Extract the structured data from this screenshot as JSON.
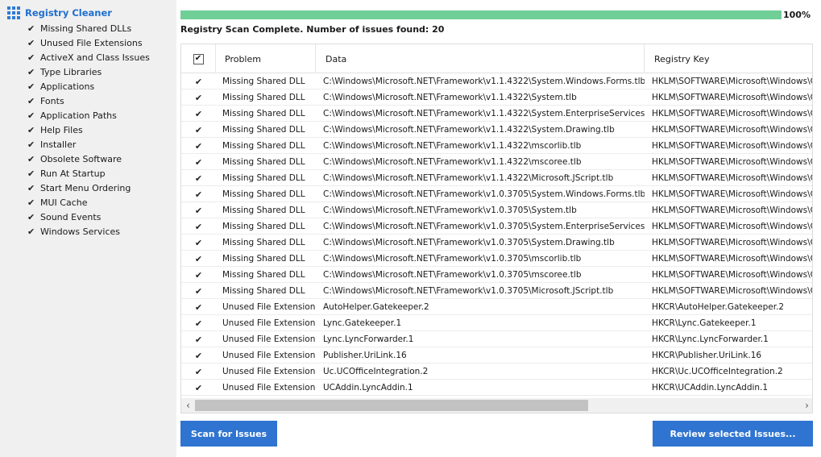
{
  "sidebar": {
    "title": "Registry Cleaner",
    "items": [
      {
        "label": "Missing Shared DLLs",
        "checked": true
      },
      {
        "label": "Unused File Extensions",
        "checked": true
      },
      {
        "label": "ActiveX and Class Issues",
        "checked": true
      },
      {
        "label": "Type Libraries",
        "checked": true
      },
      {
        "label": "Applications",
        "checked": true
      },
      {
        "label": "Fonts",
        "checked": true
      },
      {
        "label": "Application Paths",
        "checked": true
      },
      {
        "label": "Help Files",
        "checked": true
      },
      {
        "label": "Installer",
        "checked": true
      },
      {
        "label": "Obsolete Software",
        "checked": true
      },
      {
        "label": "Run At Startup",
        "checked": true
      },
      {
        "label": "Start Menu Ordering",
        "checked": true
      },
      {
        "label": "MUI Cache",
        "checked": true
      },
      {
        "label": "Sound Events",
        "checked": true
      },
      {
        "label": "Windows Services",
        "checked": true
      }
    ]
  },
  "progress": {
    "value": 1.0,
    "label": "100%"
  },
  "status_text": "Registry Scan Complete. Number of issues found: 20",
  "table": {
    "columns": [
      "Problem",
      "Data",
      "Registry Key"
    ],
    "header_checked": true,
    "rows": [
      {
        "problem": "Missing Shared DLL",
        "data": "C:\\Windows\\Microsoft.NET\\Framework\\v1.1.4322\\System.Windows.Forms.tlb",
        "key": "HKLM\\SOFTWARE\\Microsoft\\Windows\\Cur"
      },
      {
        "problem": "Missing Shared DLL",
        "data": "C:\\Windows\\Microsoft.NET\\Framework\\v1.1.4322\\System.tlb",
        "key": "HKLM\\SOFTWARE\\Microsoft\\Windows\\Cur"
      },
      {
        "problem": "Missing Shared DLL",
        "data": "C:\\Windows\\Microsoft.NET\\Framework\\v1.1.4322\\System.EnterpriseServices.tlb",
        "key": "HKLM\\SOFTWARE\\Microsoft\\Windows\\Cur"
      },
      {
        "problem": "Missing Shared DLL",
        "data": "C:\\Windows\\Microsoft.NET\\Framework\\v1.1.4322\\System.Drawing.tlb",
        "key": "HKLM\\SOFTWARE\\Microsoft\\Windows\\Cur"
      },
      {
        "problem": "Missing Shared DLL",
        "data": "C:\\Windows\\Microsoft.NET\\Framework\\v1.1.4322\\mscorlib.tlb",
        "key": "HKLM\\SOFTWARE\\Microsoft\\Windows\\Cur"
      },
      {
        "problem": "Missing Shared DLL",
        "data": "C:\\Windows\\Microsoft.NET\\Framework\\v1.1.4322\\mscoree.tlb",
        "key": "HKLM\\SOFTWARE\\Microsoft\\Windows\\Cur"
      },
      {
        "problem": "Missing Shared DLL",
        "data": "C:\\Windows\\Microsoft.NET\\Framework\\v1.1.4322\\Microsoft.JScript.tlb",
        "key": "HKLM\\SOFTWARE\\Microsoft\\Windows\\Cur"
      },
      {
        "problem": "Missing Shared DLL",
        "data": "C:\\Windows\\Microsoft.NET\\Framework\\v1.0.3705\\System.Windows.Forms.tlb",
        "key": "HKLM\\SOFTWARE\\Microsoft\\Windows\\Cur"
      },
      {
        "problem": "Missing Shared DLL",
        "data": "C:\\Windows\\Microsoft.NET\\Framework\\v1.0.3705\\System.tlb",
        "key": "HKLM\\SOFTWARE\\Microsoft\\Windows\\Cur"
      },
      {
        "problem": "Missing Shared DLL",
        "data": "C:\\Windows\\Microsoft.NET\\Framework\\v1.0.3705\\System.EnterpriseServices.tlb",
        "key": "HKLM\\SOFTWARE\\Microsoft\\Windows\\Cur"
      },
      {
        "problem": "Missing Shared DLL",
        "data": "C:\\Windows\\Microsoft.NET\\Framework\\v1.0.3705\\System.Drawing.tlb",
        "key": "HKLM\\SOFTWARE\\Microsoft\\Windows\\Cur"
      },
      {
        "problem": "Missing Shared DLL",
        "data": "C:\\Windows\\Microsoft.NET\\Framework\\v1.0.3705\\mscorlib.tlb",
        "key": "HKLM\\SOFTWARE\\Microsoft\\Windows\\Cur"
      },
      {
        "problem": "Missing Shared DLL",
        "data": "C:\\Windows\\Microsoft.NET\\Framework\\v1.0.3705\\mscoree.tlb",
        "key": "HKLM\\SOFTWARE\\Microsoft\\Windows\\Cur"
      },
      {
        "problem": "Missing Shared DLL",
        "data": "C:\\Windows\\Microsoft.NET\\Framework\\v1.0.3705\\Microsoft.JScript.tlb",
        "key": "HKLM\\SOFTWARE\\Microsoft\\Windows\\Cur"
      },
      {
        "problem": "Unused File Extension",
        "data": "AutoHelper.Gatekeeper.2",
        "key": "HKCR\\AutoHelper.Gatekeeper.2"
      },
      {
        "problem": "Unused File Extension",
        "data": "Lync.Gatekeeper.1",
        "key": "HKCR\\Lync.Gatekeeper.1"
      },
      {
        "problem": "Unused File Extension",
        "data": "Lync.LyncForwarder.1",
        "key": "HKCR\\Lync.LyncForwarder.1"
      },
      {
        "problem": "Unused File Extension",
        "data": "Publisher.UriLink.16",
        "key": "HKCR\\Publisher.UriLink.16"
      },
      {
        "problem": "Unused File Extension",
        "data": "Uc.UCOfficeIntegration.2",
        "key": "HKCR\\Uc.UCOfficeIntegration.2"
      },
      {
        "problem": "Unused File Extension",
        "data": "UCAddin.LyncAddin.1",
        "key": "HKCR\\UCAddin.LyncAddin.1"
      }
    ]
  },
  "buttons": {
    "scan": "Scan for Issues",
    "review": "Review selected Issues..."
  },
  "icons": {
    "header": "grid-icon",
    "check": "check-icon",
    "scroll_left": "chevron-left-icon",
    "scroll_right": "chevron-right-icon"
  },
  "colors": {
    "accent": "#2f74d0",
    "title_blue": "#1f6fd0",
    "progress": "#6fcf97",
    "sidebar_bg": "#f0f0f0"
  }
}
